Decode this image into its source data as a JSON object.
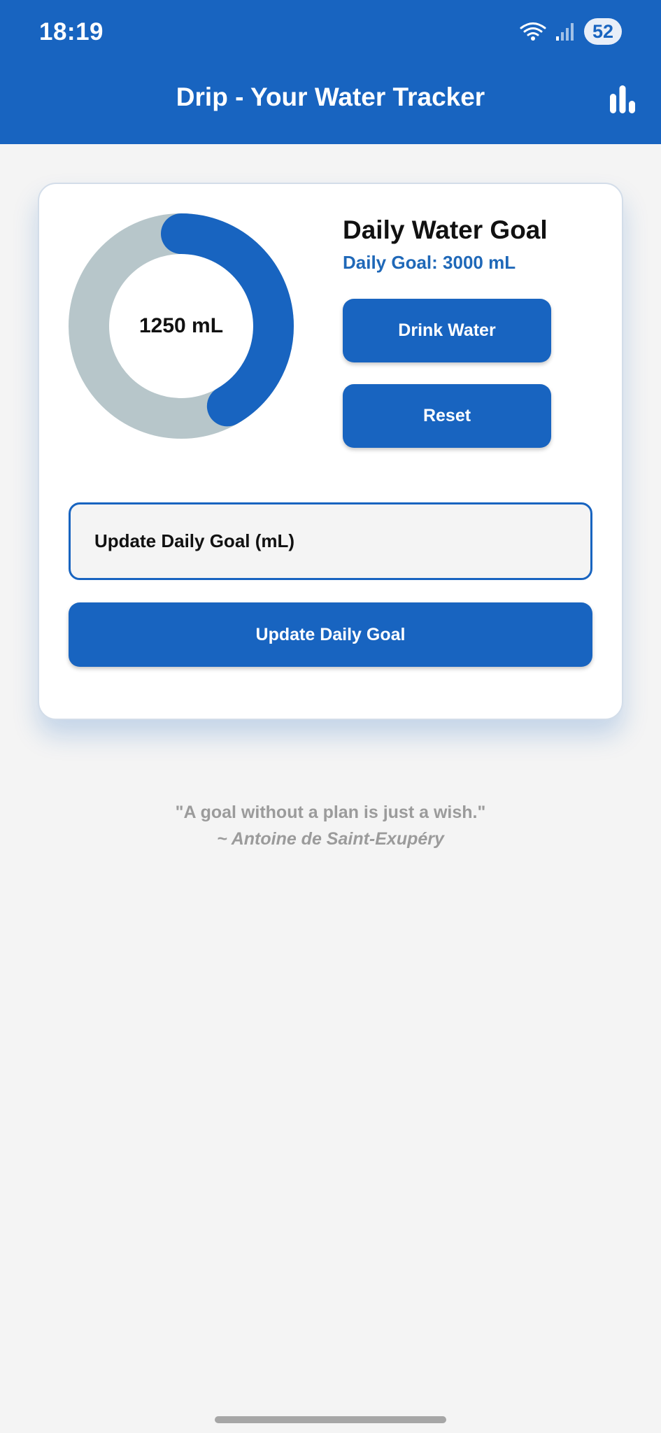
{
  "status": {
    "time": "18:19",
    "battery": "52"
  },
  "appbar": {
    "title": "Drip - Your Water Tracker"
  },
  "progress": {
    "current_label": "1250 mL",
    "current_ml": 1250,
    "goal_ml": 3000
  },
  "goal_panel": {
    "title": "Daily Water Goal",
    "subtitle": "Daily Goal: 3000 mL"
  },
  "buttons": {
    "drink": "Drink Water",
    "reset": "Reset",
    "update": "Update Daily Goal"
  },
  "goal_input": {
    "placeholder": "Update Daily Goal (mL)"
  },
  "quote": {
    "text": "\"A goal without a plan is just a wish.\"",
    "author": "~ Antoine de Saint-Exupéry"
  },
  "colors": {
    "primary": "#1864c0",
    "ring_track": "#b7c6ca",
    "background": "#f4f4f4"
  }
}
